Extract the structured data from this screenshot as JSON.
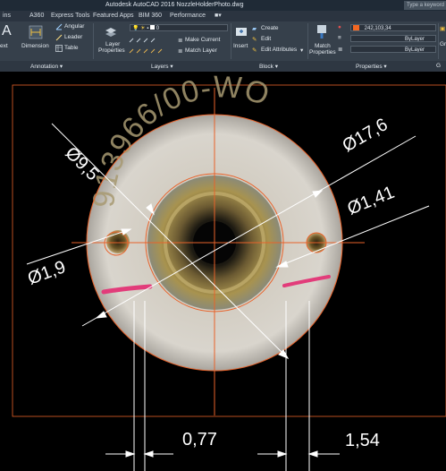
{
  "title_bar": {
    "title": "Autodesk AutoCAD 2016    NozzleHolderPhoto.dwg",
    "search_placeholder": "Type a keyword"
  },
  "tabs": [
    {
      "label": "ins"
    },
    {
      "label": "A360"
    },
    {
      "label": "Express Tools"
    },
    {
      "label": "Featured Apps"
    },
    {
      "label": "BIM 360"
    },
    {
      "label": "Performance"
    }
  ],
  "ribbon": {
    "annotation": {
      "select_label": "ext",
      "dimension_label": "Dimension",
      "angular_label": "Angular",
      "leader_label": "Leader",
      "table_label": "Table",
      "panel_label": "Annotation ▾"
    },
    "layers": {
      "layer_properties_line1": "Layer",
      "layer_properties_line2": "Properties",
      "layer_value": "0",
      "make_current_label": "Make Current",
      "match_layer_label": "Match Layer",
      "panel_label": "Layers ▾"
    },
    "block": {
      "insert_label": "Insert",
      "create_label": "Create",
      "edit_label": "Edit",
      "edit_attributes_label": "Edit Attributes",
      "panel_label": "Block ▾"
    },
    "properties": {
      "match_line1": "Match",
      "match_line2": "Properties",
      "color_value": "242,103,34",
      "linetype_value": "ByLayer",
      "lineweight_value": "ByLayer",
      "panel_label": "Properties ▾",
      "color_hex": "#f26722"
    },
    "groups": {
      "cut_label": "Gr",
      "panel_label": "G"
    }
  },
  "drawing": {
    "dim_outer_diameter": "Ø17,6",
    "dim_bore": "Ø9,5",
    "dim_left_hole": "Ø1,9",
    "dim_right_hole": "Ø1,41",
    "dim_bottom_left": "0,77",
    "dim_bottom_right": "1,54",
    "engraving": "913966/00-WO",
    "line_color": "#e8622a"
  }
}
